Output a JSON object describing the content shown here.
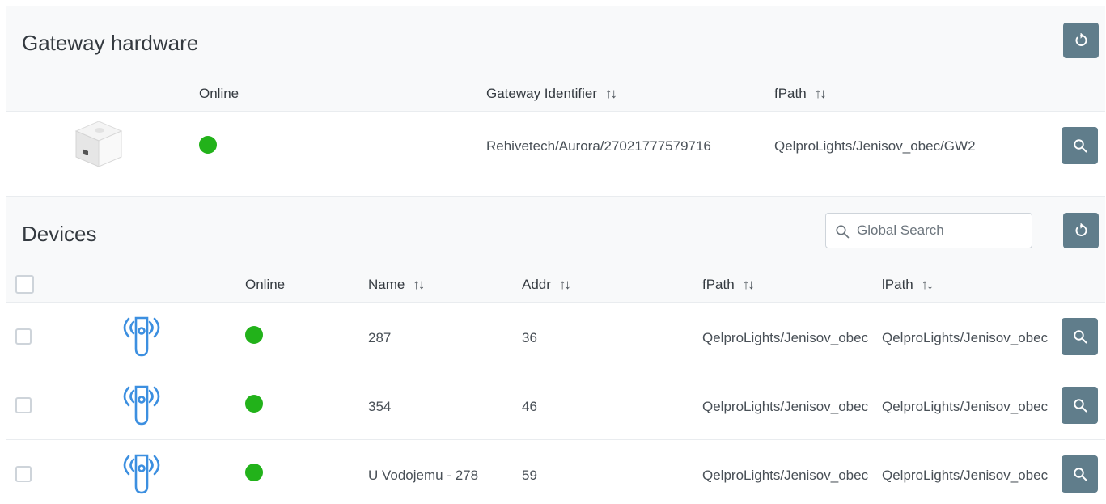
{
  "gateway": {
    "title": "Gateway hardware",
    "columns": {
      "online": "Online",
      "identifier": "Gateway Identifier",
      "fpath": "fPath"
    },
    "rows": [
      {
        "online": true,
        "identifier": "Rehivetech/Aurora/27021777579716",
        "fpath": "QelproLights/Jenisov_obec/GW2"
      }
    ]
  },
  "devices": {
    "title": "Devices",
    "search_placeholder": "Global Search",
    "columns": {
      "online": "Online",
      "name": "Name",
      "addr": "Addr",
      "fpath": "fPath",
      "lpath": "lPath"
    },
    "rows": [
      {
        "online": true,
        "name": "287",
        "addr": "36",
        "fpath": "QelproLights/Jenisov_obec",
        "lpath": "QelproLights/Jenisov_obec"
      },
      {
        "online": true,
        "name": "354",
        "addr": "46",
        "fpath": "QelproLights/Jenisov_obec",
        "lpath": "QelproLights/Jenisov_obec"
      },
      {
        "online": true,
        "name": "U Vodojemu - 278",
        "addr": "59",
        "fpath": "QelproLights/Jenisov_obec",
        "lpath": "QelproLights/Jenisov_obec"
      }
    ]
  },
  "icons": {
    "refresh": "refresh-icon",
    "search": "search-icon",
    "sort": "sort-icon",
    "gateway_device": "gateway-device-image",
    "wireless_sensor": "wireless-sensor-icon"
  },
  "colors": {
    "online": "#22b21a",
    "button": "#607d8b",
    "device_icon": "#3c8fe0",
    "header_bg": "#f8f9fa"
  }
}
